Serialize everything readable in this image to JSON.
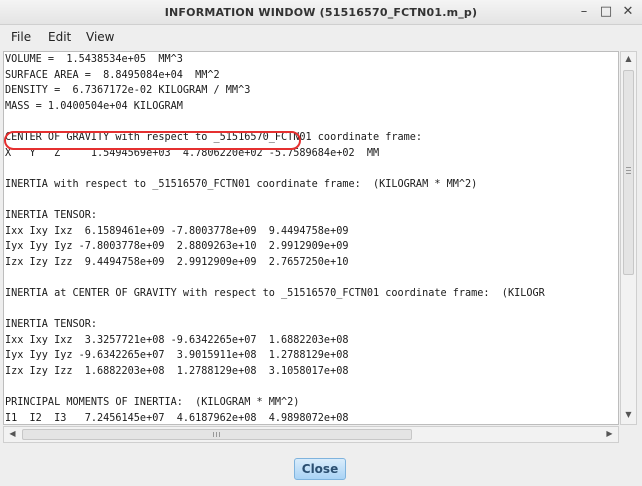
{
  "window": {
    "title": "INFORMATION  WINDOW (51516570_FCTN01.m_p)"
  },
  "menu": {
    "file": "File",
    "edit": "Edit",
    "view": "View"
  },
  "report": {
    "lines": [
      "VOLUME =  1.5438534e+05  MM^3",
      "SURFACE AREA =  8.8495084e+04  MM^2",
      "DENSITY =  6.7367172e-02 KILOGRAM / MM^3",
      "MASS = 1.0400504e+04 KILOGRAM",
      "",
      "CENTER OF GRAVITY with respect to _51516570_FCTN01 coordinate frame:",
      "X   Y   Z     1.5494569e+03  4.7806220e+02 -5.7589684e+02  MM",
      "",
      "INERTIA with respect to _51516570_FCTN01 coordinate frame:  (KILOGRAM * MM^2)",
      "",
      "INERTIA TENSOR:",
      "Ixx Ixy Ixz  6.1589461e+09 -7.8003778e+09  9.4494758e+09",
      "Iyx Iyy Iyz -7.8003778e+09  2.8809263e+10  2.9912909e+09",
      "Izx Izy Izz  9.4494758e+09  2.9912909e+09  2.7657250e+10",
      "",
      "INERTIA at CENTER OF GRAVITY with respect to _51516570_FCTN01 coordinate frame:  (KILOGR",
      "",
      "INERTIA TENSOR:",
      "Ixx Ixy Ixz  3.3257721e+08 -9.6342265e+07  1.6882203e+08",
      "Iyx Iyy Iyz -9.6342265e+07  3.9015911e+08  1.2788129e+08",
      "Izx Izy Izz  1.6882203e+08  1.2788129e+08  3.1058017e+08",
      "",
      "PRINCIPAL MOMENTS OF INERTIA:  (KILOGRAM * MM^2)",
      "I1  I2  I3   7.2456145e+07  4.6187962e+08  4.9898072e+08"
    ]
  },
  "buttons": {
    "close": "Close"
  },
  "controls": {
    "minimize_icon": "minimize-icon",
    "maximize_icon": "maximize-icon",
    "close_icon": "close-icon"
  },
  "colors": {
    "highlight": "#e53030",
    "button_accent": "#a9d3f5"
  }
}
